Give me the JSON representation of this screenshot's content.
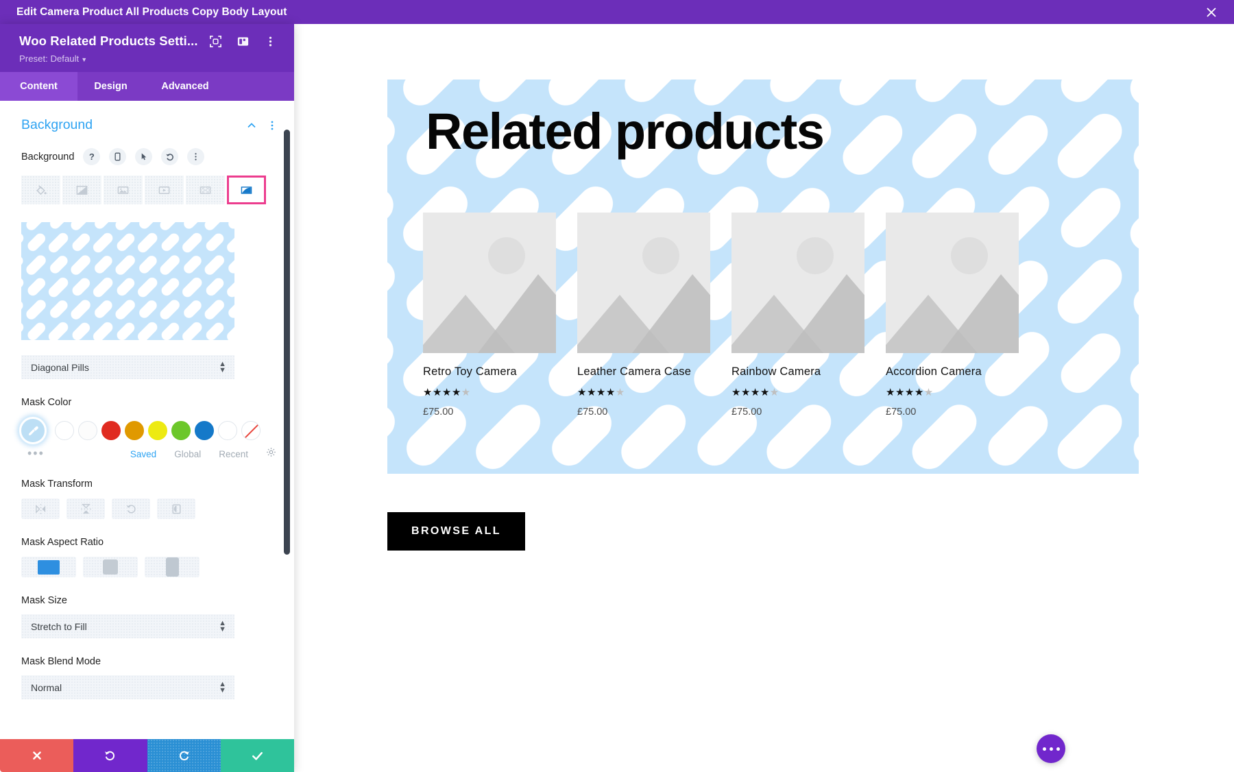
{
  "topbar": {
    "title": "Edit Camera Product All Products Copy Body Layout",
    "close_icon": "close-icon"
  },
  "panel": {
    "title": "Woo Related Products Setti...",
    "preset_label": "Preset: Default",
    "head_icons": [
      "focus-target-icon",
      "layout-columns-icon",
      "vertical-ellipsis-icon"
    ],
    "tabs": [
      {
        "label": "Content",
        "active": true
      },
      {
        "label": "Design",
        "active": false
      },
      {
        "label": "Advanced",
        "active": false
      }
    ],
    "section": {
      "title": "Background",
      "collapse_icon": "chevron-up-icon",
      "options_icon": "vertical-ellipsis-icon"
    },
    "background_field": {
      "label": "Background",
      "mini_buttons": [
        "help-icon",
        "responsive-phone-icon",
        "hover-cursor-icon",
        "reset-undo-icon",
        "vertical-ellipsis-icon"
      ],
      "types": [
        {
          "name": "background-color",
          "selected": false
        },
        {
          "name": "background-gradient",
          "selected": false
        },
        {
          "name": "background-image",
          "selected": false
        },
        {
          "name": "background-video",
          "selected": false
        },
        {
          "name": "background-pattern",
          "selected": false
        },
        {
          "name": "background-mask",
          "selected": true
        }
      ]
    },
    "mask_style": {
      "value": "Diagonal Pills",
      "arrows_icon": "select-arrows-icon"
    },
    "mask_color": {
      "label": "Mask Color",
      "picker_icon": "eyedropper-icon",
      "swatches": [
        {
          "name": "swatch-white-1",
          "color": "#ffffff"
        },
        {
          "name": "swatch-white-2",
          "color": "#fcfcfc"
        },
        {
          "name": "swatch-red",
          "color": "#e02b20"
        },
        {
          "name": "swatch-orange",
          "color": "#e09900"
        },
        {
          "name": "swatch-yellow",
          "color": "#edea12"
        },
        {
          "name": "swatch-green",
          "color": "#6cc72a"
        },
        {
          "name": "swatch-blue",
          "color": "#1579c9"
        },
        {
          "name": "swatch-white-3",
          "color": "#ffffff"
        },
        {
          "name": "swatch-transparent",
          "color": "transparent"
        }
      ],
      "more_dots": "•••",
      "tabs": [
        {
          "label": "Saved",
          "active": true
        },
        {
          "label": "Global",
          "active": false
        },
        {
          "label": "Recent",
          "active": false
        }
      ],
      "settings_icon": "gear-icon"
    },
    "mask_transform": {
      "label": "Mask Transform",
      "buttons": [
        "flip-horizontal-icon",
        "flip-vertical-icon",
        "rotate-icon",
        "invert-icon"
      ]
    },
    "mask_aspect_ratio": {
      "label": "Mask Aspect Ratio",
      "options": [
        {
          "name": "aspect-landscape",
          "selected": true
        },
        {
          "name": "aspect-square",
          "selected": false
        },
        {
          "name": "aspect-portrait",
          "selected": false
        }
      ]
    },
    "mask_size": {
      "label": "Mask Size",
      "value": "Stretch to Fill"
    },
    "mask_blend_mode": {
      "label": "Mask Blend Mode",
      "value": "Normal"
    },
    "footer": {
      "cancel": "close-x-icon",
      "undo": "undo-icon",
      "redo": "redo-icon",
      "save": "checkmark-icon"
    }
  },
  "canvas": {
    "hero_title": "Related products",
    "mask_background_color": "#c5e4fb",
    "mask_shape_color": "#ffffff",
    "products": [
      {
        "name": "Retro Toy Camera",
        "rating_filled": 4,
        "rating_total": 5,
        "price": "£75.00"
      },
      {
        "name": "Leather Camera Case",
        "rating_filled": 4,
        "rating_total": 5,
        "price": "£75.00"
      },
      {
        "name": "Rainbow Camera",
        "rating_filled": 4,
        "rating_total": 5,
        "price": "£75.00"
      },
      {
        "name": "Accordion Camera",
        "rating_filled": 4,
        "rating_total": 5,
        "price": "£75.00"
      }
    ],
    "browse_button": "BROWSE ALL",
    "fab": "more-options-fab"
  }
}
